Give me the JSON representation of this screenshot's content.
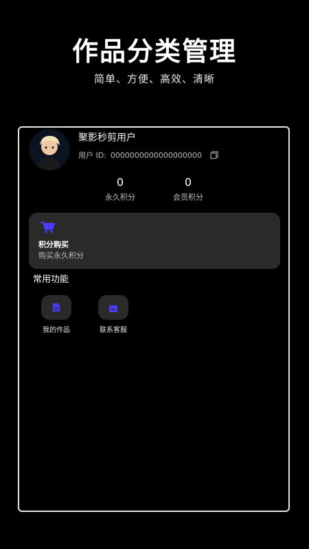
{
  "hero": {
    "title": "作品分类管理",
    "subtitle": "简单、方便、高效、清晰"
  },
  "profile": {
    "username": "聚影秒剪用户",
    "user_id_label": "用户 ID:",
    "user_id_value": "0000000000000000000",
    "copy_icon": "copy-icon"
  },
  "stats": [
    {
      "value": "0",
      "label": "永久积分"
    },
    {
      "value": "0",
      "label": "会员积分"
    }
  ],
  "purchase": {
    "icon": "cart-icon",
    "title": "积分购买",
    "subtitle": "购买永久积分"
  },
  "functions": {
    "title": "常用功能",
    "items": [
      {
        "label": "我的作品",
        "icon": "document-icon"
      },
      {
        "label": "联系客服",
        "icon": "mail-icon"
      }
    ]
  },
  "colors": {
    "background": "#000000",
    "card": "#2a2a2a",
    "accent": "#4a3cff"
  }
}
